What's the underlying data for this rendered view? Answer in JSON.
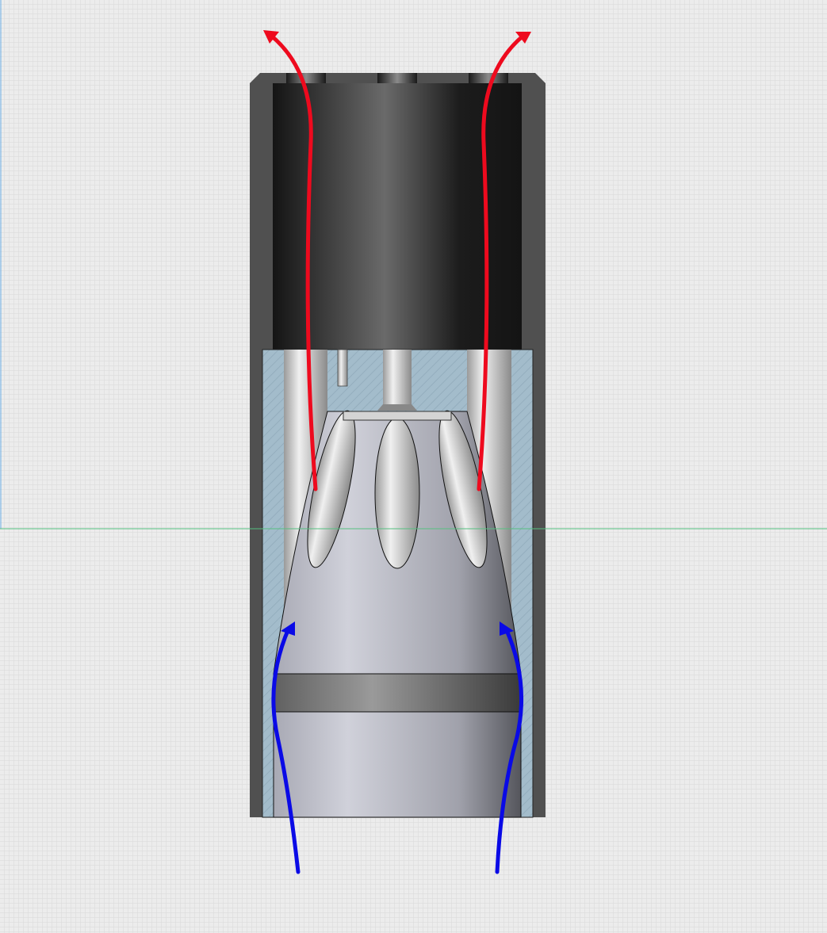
{
  "diagram": {
    "colors": {
      "background": "#e8e8e8",
      "grid_line": "#d8d8d8",
      "housing": "#505050",
      "inner_cylinder": "#1a1a1a",
      "hatched_section": "#a3bccb",
      "cone_body": "#b4b6c0",
      "exhaust_arrow": "#ee0a1e",
      "intake_arrow": "#0a0ae6",
      "guide_horizontal": "#55c080",
      "guide_vertical": "#6aaee6"
    },
    "icons": [
      "exhaust-arrow-icon",
      "intake-arrow-icon"
    ]
  }
}
